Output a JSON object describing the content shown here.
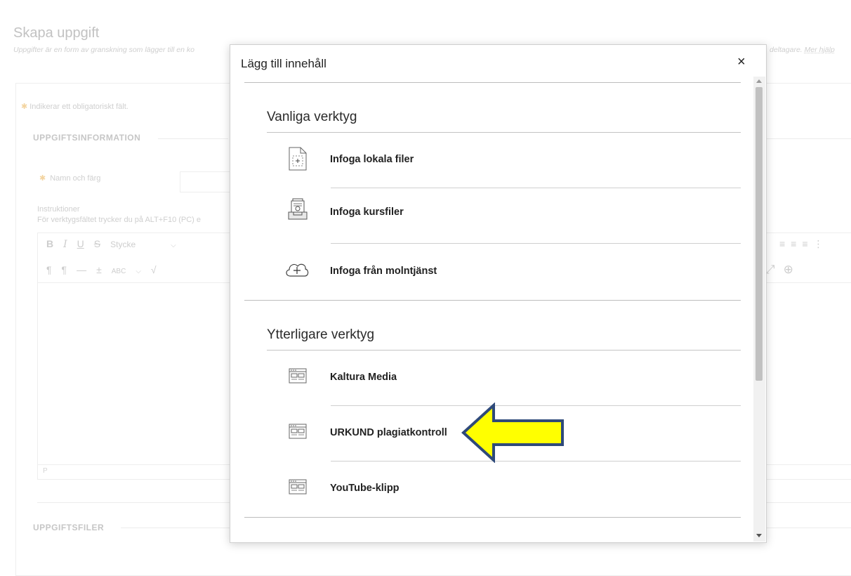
{
  "background": {
    "page_title": "Skapa uppgift",
    "description": "Uppgifter är en form av granskning som lägger till en ko",
    "description_tail": "deltagare.",
    "help_link": "Mer hjälp",
    "required_note": "Indikerar ett obligatoriskt fält.",
    "section_info": "UPPGIFTSINFORMATION",
    "name_color_label": "Namn och färg",
    "instructions_label": "Instruktioner",
    "instructions_hint": "För verktygsfältet trycker du på ALT+F10 (PC) e",
    "toolbar_style": "Stycke",
    "editor_path": "P",
    "section_files": "UPPGIFTSFILER"
  },
  "modal": {
    "title": "Lägg till innehåll",
    "close_label": "×",
    "groups": [
      {
        "heading": "Vanliga verktyg",
        "items": [
          {
            "label": "Infoga lokala filer",
            "icon": "local-file-icon"
          },
          {
            "label": "Infoga kursfiler",
            "icon": "course-files-icon"
          },
          {
            "label": "Infoga från molntjänst",
            "icon": "cloud-add-icon"
          }
        ]
      },
      {
        "heading": "Ytterligare verktyg",
        "items": [
          {
            "label": "Kaltura Media",
            "icon": "tool-window-icon"
          },
          {
            "label": "URKUND plagiatkontroll",
            "icon": "tool-window-icon"
          },
          {
            "label": "YouTube-klipp",
            "icon": "tool-window-icon"
          }
        ]
      }
    ]
  },
  "annotation": {
    "arrow_color": "#ffff00",
    "arrow_outline": "#2f4a7a"
  }
}
